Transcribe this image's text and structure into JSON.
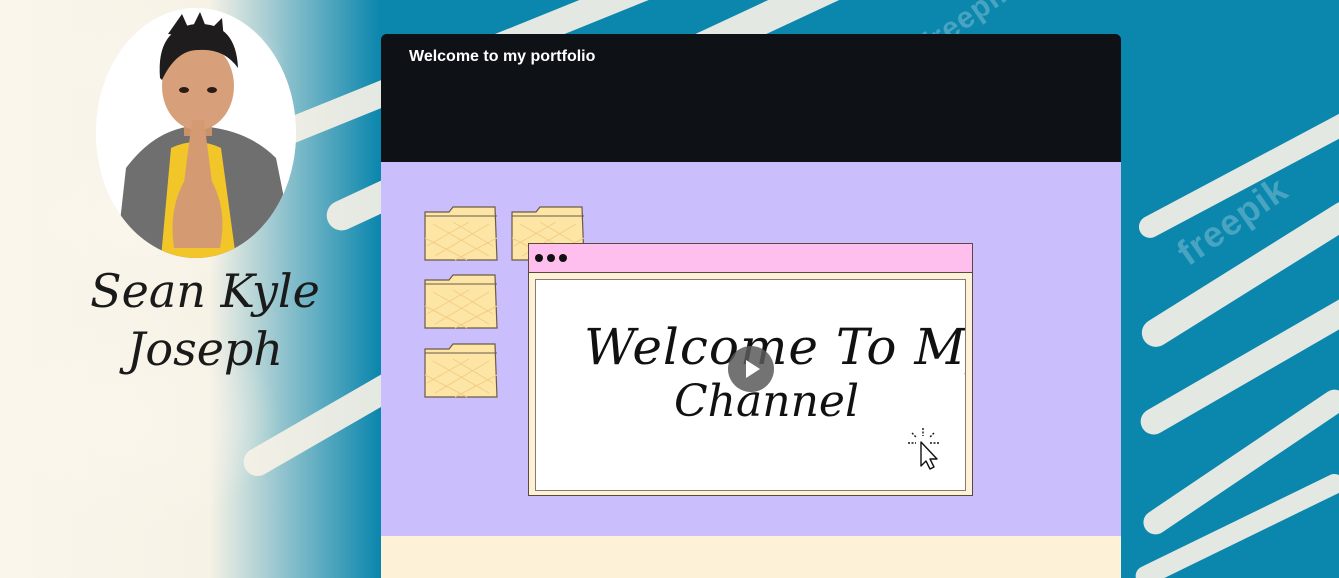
{
  "profile": {
    "name_line1": "Sean Kyle",
    "name_line2": "Joseph"
  },
  "card": {
    "title": "Welcome to my portfolio"
  },
  "video": {
    "text_line1": "Welcome To My",
    "text_line2": "Channel"
  },
  "background": {
    "watermark": "freepik"
  },
  "colors": {
    "background_blue": "#0b86ad",
    "card_header": "#0e1217",
    "card_body": "#cabffc",
    "card_footer": "#fdf2d8",
    "window_bar": "#ffbfee",
    "folder": "#fde5a6"
  },
  "icons": [
    "folder-icon",
    "play-icon",
    "cursor-click-icon"
  ]
}
